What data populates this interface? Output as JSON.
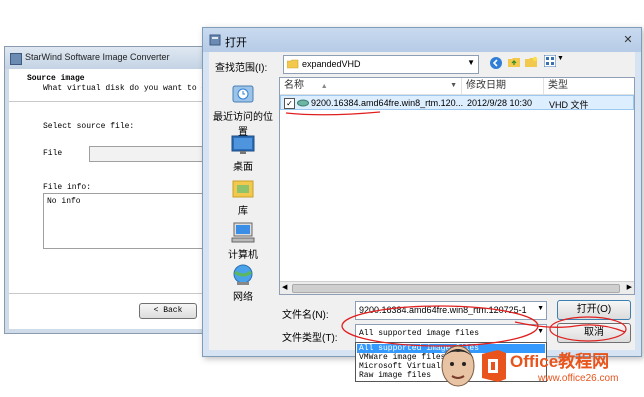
{
  "bg_window": {
    "title": "StarWind Software Image Converter",
    "section_title": "Source image",
    "section_desc": "What virtual disk do you want to co",
    "select_label": "Select source file:",
    "file_label": "File",
    "fileinfo_label": "File info:",
    "fileinfo_value": "No info",
    "back_button": "< Back"
  },
  "dialog": {
    "title": "打开",
    "lookin_label": "查找范围(I):",
    "lookin_value": "expandedVHD",
    "places": [
      {
        "label": "最近访问的位置",
        "icon": "recent-places-icon"
      },
      {
        "label": "桌面",
        "icon": "desktop-icon"
      },
      {
        "label": "库",
        "icon": "libraries-icon"
      },
      {
        "label": "计算机",
        "icon": "computer-icon"
      },
      {
        "label": "网络",
        "icon": "network-icon"
      }
    ],
    "columns": [
      "名称",
      "修改日期",
      "类型"
    ],
    "files": [
      {
        "name": "9200.16384.amd64fre.win8_rtm.120...",
        "date": "2012/9/28 10:30",
        "type": "VHD 文件"
      }
    ],
    "filename_label": "文件名(N):",
    "filename_value": "9200.16384.amd64fre.win8_rtm.120725-1",
    "filetype_label": "文件类型(T):",
    "filetype_value": "All supported image files",
    "filetype_options": [
      "All supported image files",
      "VMWare image files",
      "Microsoft Virtual",
      "Raw image files"
    ],
    "open_button": "打开(O)",
    "cancel_button": "取消"
  },
  "watermark": {
    "brand": "Office教程网",
    "url": "www.office26.com"
  },
  "colors": {
    "selection": "#3399ff",
    "accent": "#e8541c",
    "annotation": "#e02020"
  }
}
